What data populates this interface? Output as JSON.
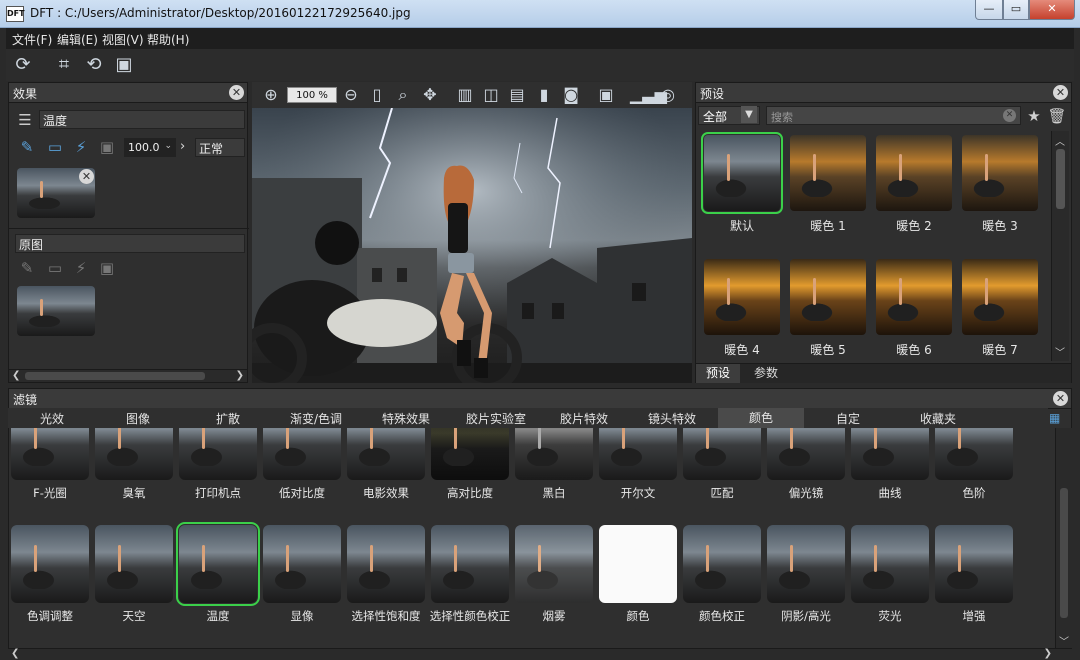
{
  "window": {
    "app_icon": "DFT",
    "title": "DFT : C:/Users/Administrator/Desktop/20160122172925640.jpg",
    "minimize": "—",
    "maximize": "▭",
    "close": "✕"
  },
  "menu": [
    "文件(F)",
    "编辑(E)",
    "视图(V)",
    "帮助(H)"
  ],
  "toolbar_icons": [
    "refresh-icon",
    "crop-icon",
    "rotate-icon",
    "fit-frame-icon"
  ],
  "effects_panel": {
    "title": "效果",
    "layer_name": "温度",
    "opacity": "100.0",
    "blend_mode": "正常",
    "source_title": "原图"
  },
  "canvas": {
    "zoom": "100 %"
  },
  "presets_panel": {
    "title": "预设",
    "category": "全部",
    "search_placeholder": "搜索",
    "items": [
      "默认",
      "暖色 1",
      "暖色 2",
      "暖色 3",
      "暖色 4",
      "暖色 5",
      "暖色 6",
      "暖色 7"
    ],
    "selected_index": 0,
    "tabs": [
      "预设",
      "参数"
    ]
  },
  "filters_panel": {
    "title": "滤镜",
    "categories": [
      "光效",
      "图像",
      "扩散",
      "渐变/色调",
      "特殊效果",
      "胶片实验室",
      "胶片特效",
      "镜头特效",
      "颜色",
      "自定",
      "收藏夹"
    ],
    "active_category": "颜色",
    "row1": [
      "F-光圈",
      "臭氧",
      "打印机点",
      "低对比度",
      "电影效果",
      "高对比度",
      "黑白",
      "开尔文",
      "匹配",
      "偏光镜",
      "曲线",
      "色阶"
    ],
    "row2": [
      "色调调整",
      "天空",
      "温度",
      "显像",
      "选择性饱和度",
      "选择性颜色校正",
      "烟雾",
      "颜色",
      "颜色校正",
      "阴影/高光",
      "荧光",
      "增强"
    ],
    "selected": "温度"
  },
  "colors": {
    "selection_green": "#3bd04a",
    "panel_bg": "#2f2f2f",
    "accent_blue": "#5aa0d8"
  }
}
